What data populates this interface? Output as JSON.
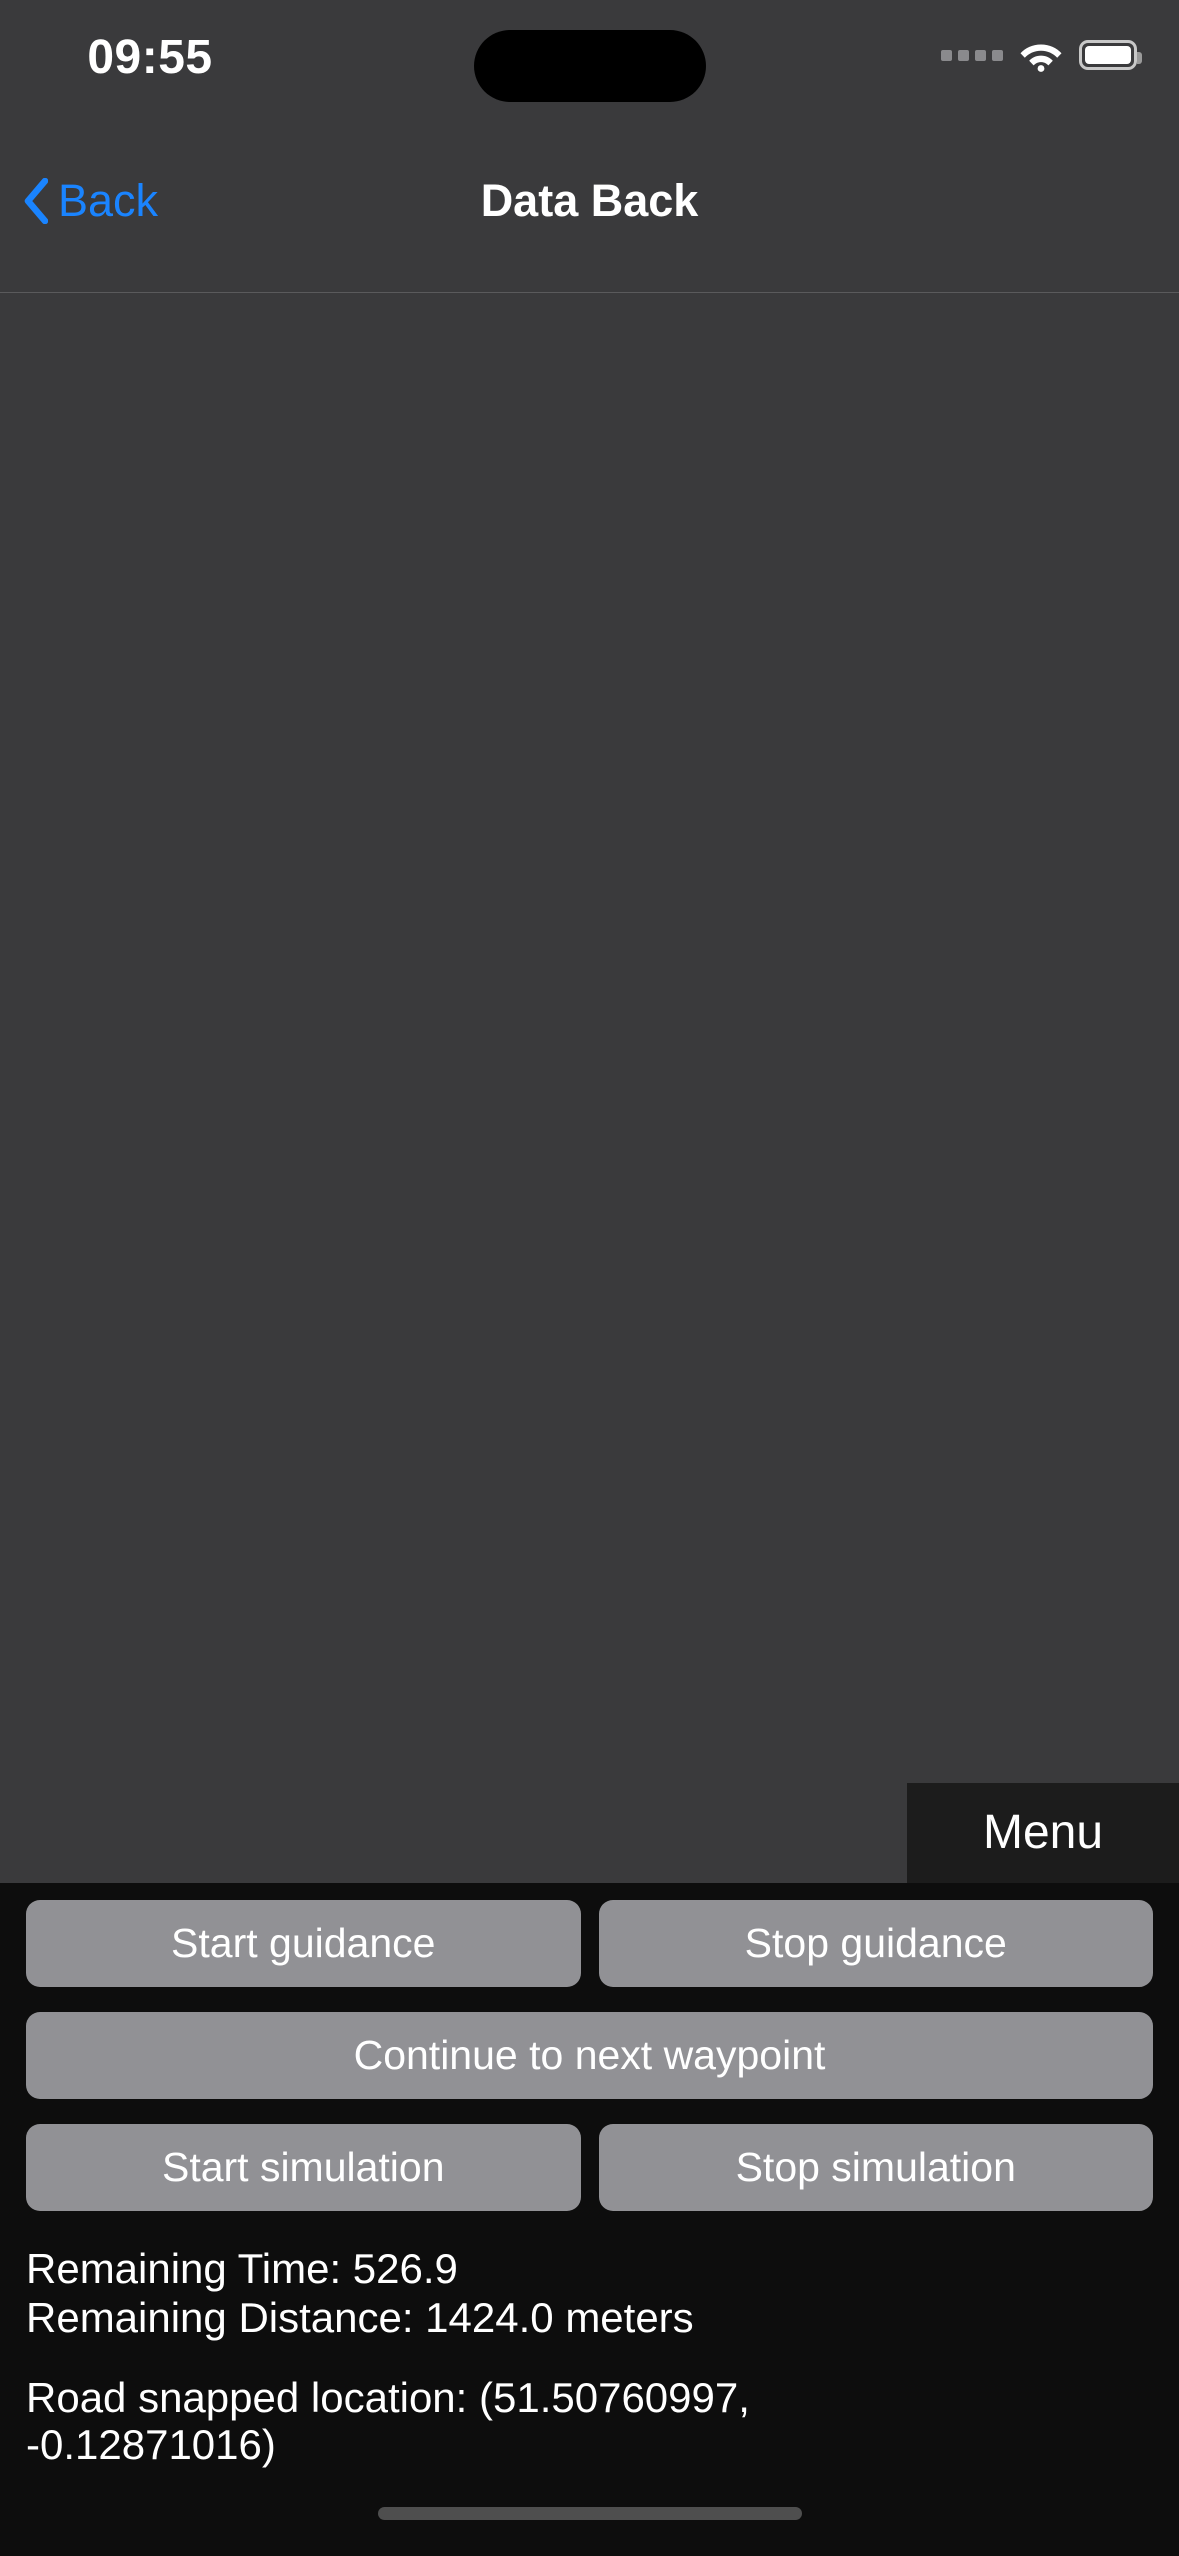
{
  "status_bar": {
    "time": "09:55",
    "cellular_icon": "signal-dots-icon",
    "wifi_icon": "wifi-icon",
    "battery_icon": "battery-full-icon"
  },
  "nav_bar": {
    "back_label": "Back",
    "back_icon": "chevron-left-icon",
    "title": "Data Back",
    "accent_color": "#1a84ff"
  },
  "map": {
    "menu_label": "Menu",
    "background_color": "#3a3a3c"
  },
  "controls": {
    "button_color": "#919195",
    "rows": [
      [
        {
          "label": "Start guidance",
          "name": "start-guidance-button"
        },
        {
          "label": "Stop guidance",
          "name": "stop-guidance-button"
        }
      ],
      [
        {
          "label": "Continue to next waypoint",
          "name": "continue-to-next-waypoint-button"
        }
      ],
      [
        {
          "label": "Start simulation",
          "name": "start-simulation-button"
        },
        {
          "label": "Stop simulation",
          "name": "stop-simulation-button"
        }
      ]
    ]
  },
  "telemetry": {
    "remaining_time": "Remaining Time: 526.9",
    "remaining_distance": "Remaining Distance: 1424.0 meters",
    "road_snapped_location": "Road snapped location: (51.50760997, -0.12871016)"
  }
}
